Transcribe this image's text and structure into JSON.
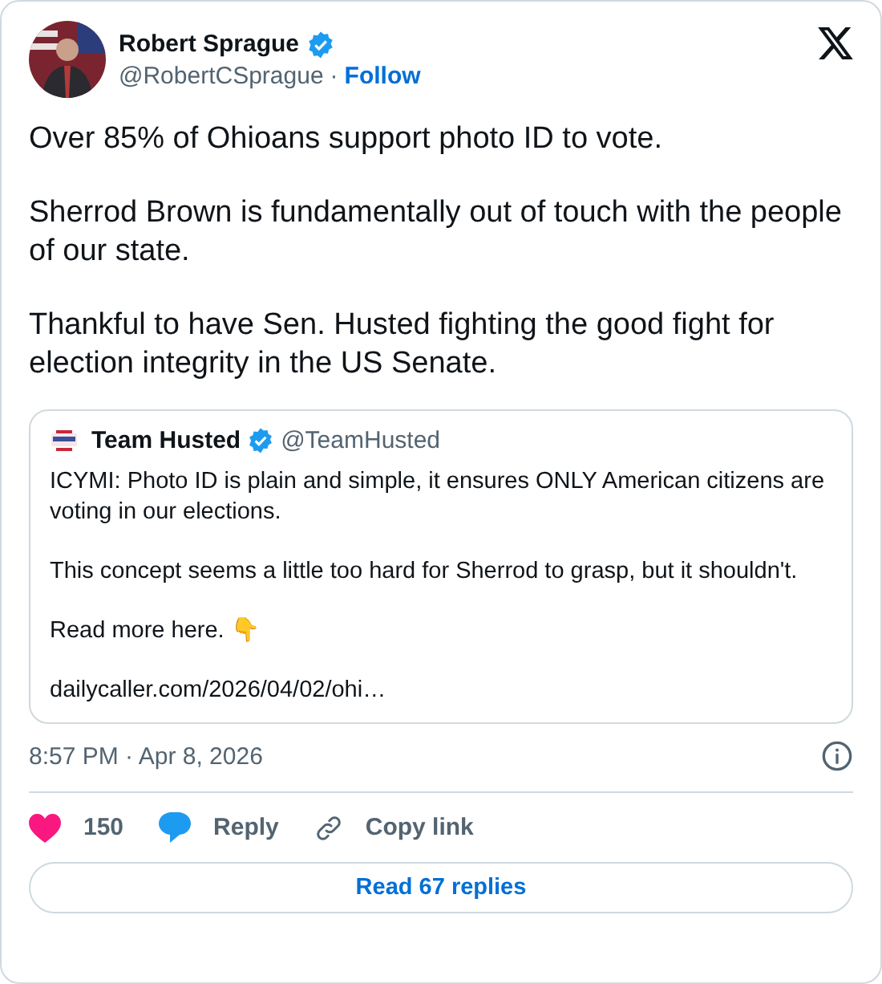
{
  "author": {
    "name": "Robert Sprague",
    "verified": true,
    "handle": "@RobertCSprague",
    "separator": "·",
    "follow": "Follow"
  },
  "paragraphs": [
    "Over 85% of Ohioans support photo ID to vote.",
    "Sherrod Brown is fundamentally out of touch with the people of our state.",
    "Thankful to have Sen. Husted fighting the good fight for election integrity in the US Senate."
  ],
  "quote": {
    "name": "Team Husted",
    "verified": true,
    "handle": "@TeamHusted",
    "paragraphs": [
      "ICYMI: Photo ID is plain and simple, it ensures ONLY American citizens are voting in our elections.",
      "This concept seems a little too hard for Sherrod to grasp, but it shouldn't.",
      "Read more here. 👇",
      "dailycaller.com/2026/04/02/ohi…"
    ]
  },
  "timestamp": "8:57 PM · Apr 8, 2026",
  "actions": [
    {
      "kind": "like",
      "label": "150"
    },
    {
      "kind": "reply",
      "label": "Reply"
    },
    {
      "kind": "copy",
      "label": "Copy link"
    }
  ],
  "read_replies": "Read 67 replies"
}
